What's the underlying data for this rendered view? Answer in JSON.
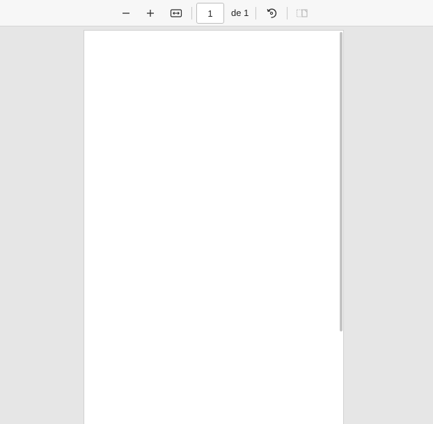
{
  "toolbar": {
    "zoom_out_icon": "minus-icon",
    "zoom_in_icon": "plus-icon",
    "fit_width_icon": "fit-width-icon",
    "page_number": "1",
    "page_total": "de 1",
    "rotate_icon": "rotate-icon",
    "two_page_icon": "two-page-view-icon"
  },
  "document": {
    "page_count": 1,
    "current_page": 1
  },
  "colors": {
    "toolbar_bg": "#f7f7f7",
    "viewer_bg": "#e6e6e6",
    "page_bg": "#ffffff",
    "icon": "#2b2b2b",
    "icon_disabled": "#b8b8b8"
  }
}
